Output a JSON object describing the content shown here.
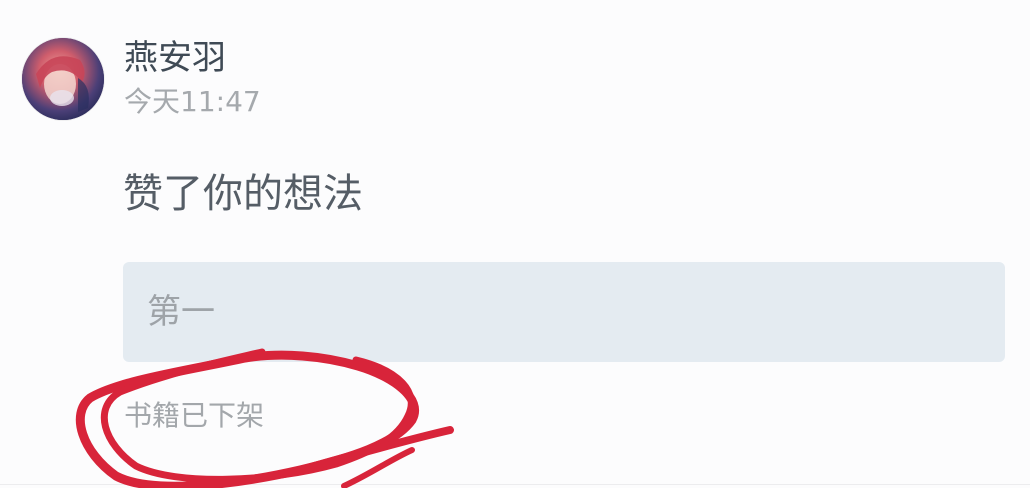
{
  "post": {
    "author_name": "燕安羽",
    "time": "今天11:47",
    "action_text": "赞了你的想法",
    "quoted_idea": "第一",
    "book_status": "书籍已下架"
  },
  "colors": {
    "annotation": "#d8243a",
    "quote_background": "#e4ebf1"
  },
  "icons": {
    "avatar": "user-avatar-image",
    "annotation": "hand-drawn-circle-annotation"
  }
}
